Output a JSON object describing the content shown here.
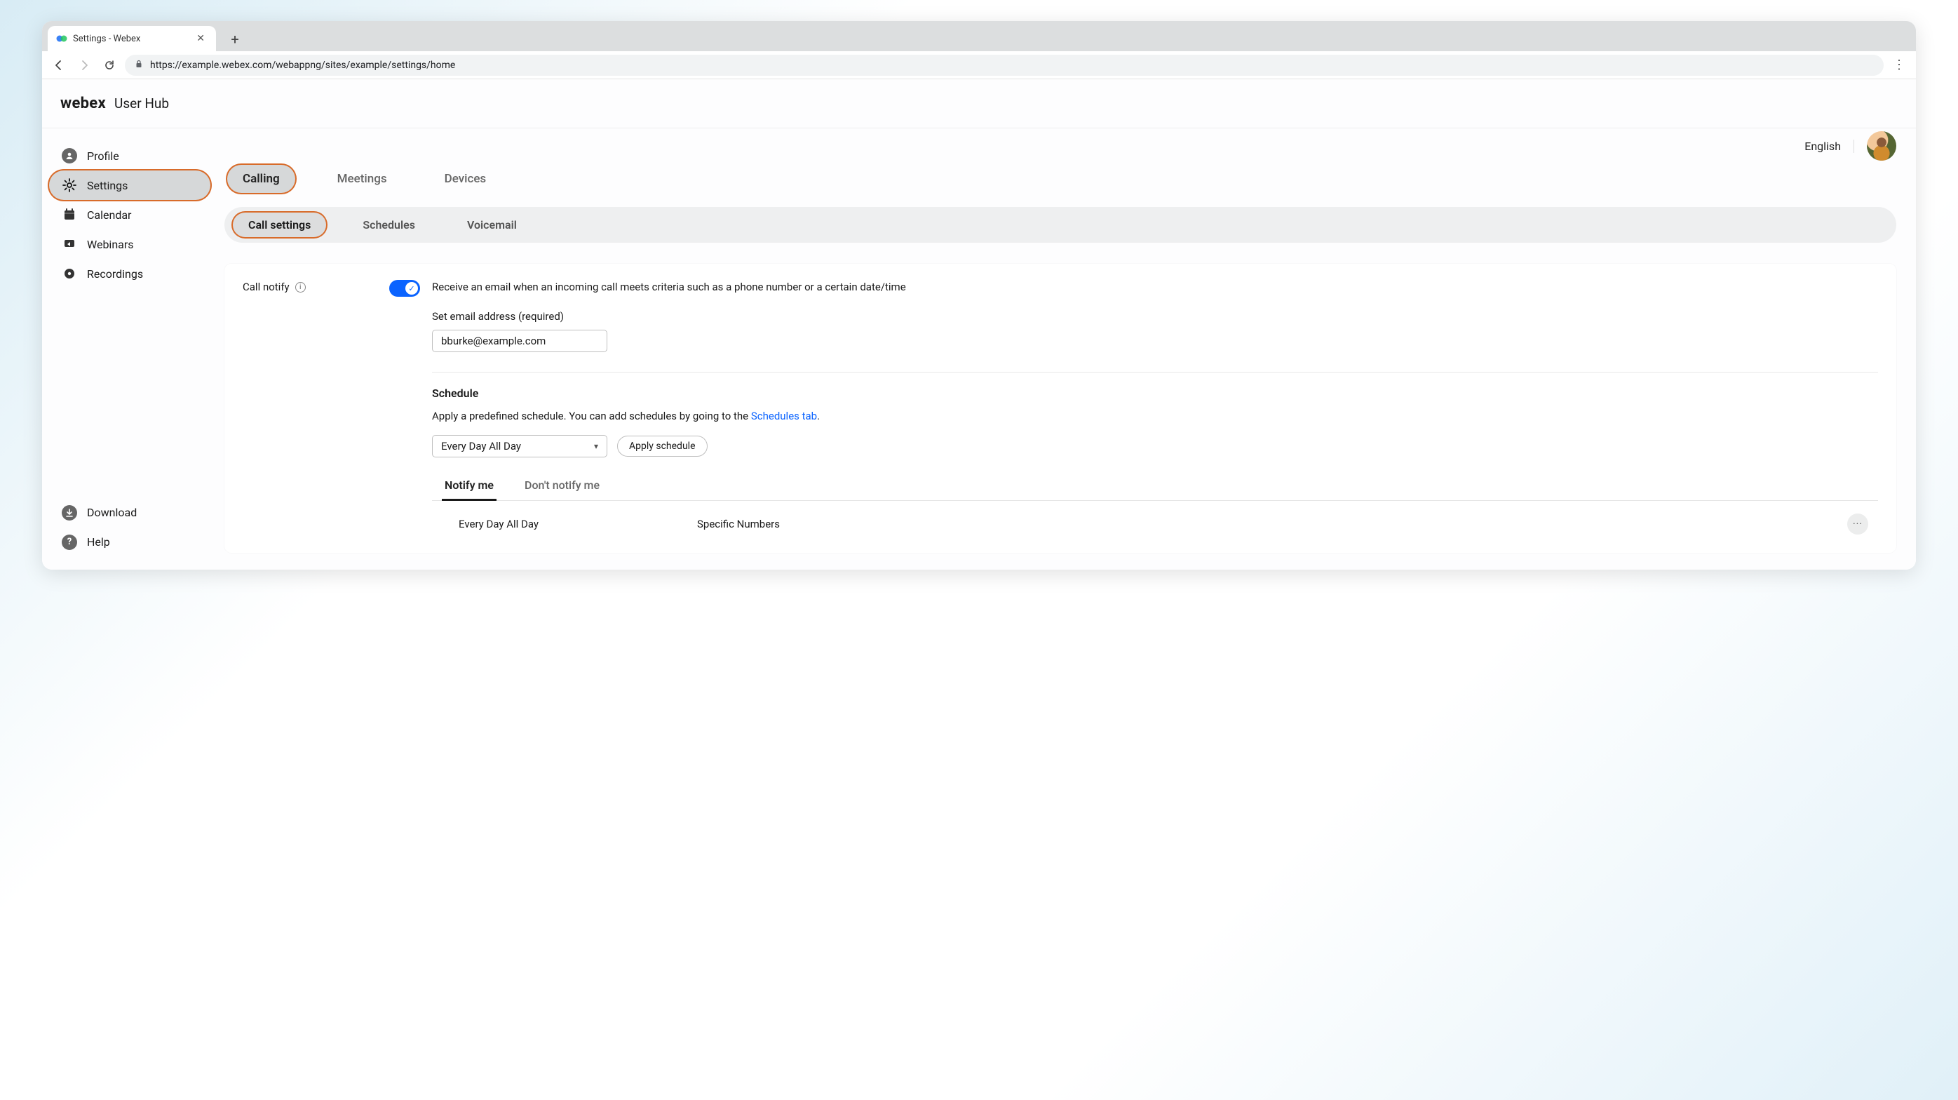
{
  "browser": {
    "tab_title": "Settings - Webex",
    "url": "https://example.webex.com/webappng/sites/example/settings/home"
  },
  "brand": {
    "logo": "webex",
    "sub": "User Hub"
  },
  "top_right": {
    "language": "English"
  },
  "sidebar": {
    "items": [
      {
        "id": "profile",
        "label": "Profile"
      },
      {
        "id": "settings",
        "label": "Settings"
      },
      {
        "id": "calendar",
        "label": "Calendar"
      },
      {
        "id": "webinars",
        "label": "Webinars"
      },
      {
        "id": "recordings",
        "label": "Recordings"
      }
    ],
    "bottom": [
      {
        "id": "download",
        "label": "Download"
      },
      {
        "id": "help",
        "label": "Help"
      }
    ]
  },
  "main_tabs": [
    {
      "id": "calling",
      "label": "Calling"
    },
    {
      "id": "meetings",
      "label": "Meetings"
    },
    {
      "id": "devices",
      "label": "Devices"
    }
  ],
  "sub_tabs": [
    {
      "id": "call-settings",
      "label": "Call settings"
    },
    {
      "id": "schedules",
      "label": "Schedules"
    },
    {
      "id": "voicemail",
      "label": "Voicemail"
    }
  ],
  "call_notify": {
    "label": "Call notify",
    "toggle_on": true,
    "description": "Receive an email when an incoming call meets criteria such as a phone number or a certain date/time",
    "email_label": "Set email address (required)",
    "email_value": "bburke@example.com"
  },
  "schedule": {
    "heading": "Schedule",
    "desc_prefix": "Apply a predefined schedule. You can add schedules by going to the ",
    "desc_link": "Schedules tab",
    "desc_suffix": ".",
    "selected": "Every Day All Day",
    "apply_label": "Apply schedule",
    "notify_tabs": [
      {
        "id": "notify",
        "label": "Notify me"
      },
      {
        "id": "dont-notify",
        "label": "Don't notify me"
      }
    ],
    "rows": [
      {
        "c1": "Every Day All Day",
        "c2": "Specific Numbers"
      }
    ]
  }
}
